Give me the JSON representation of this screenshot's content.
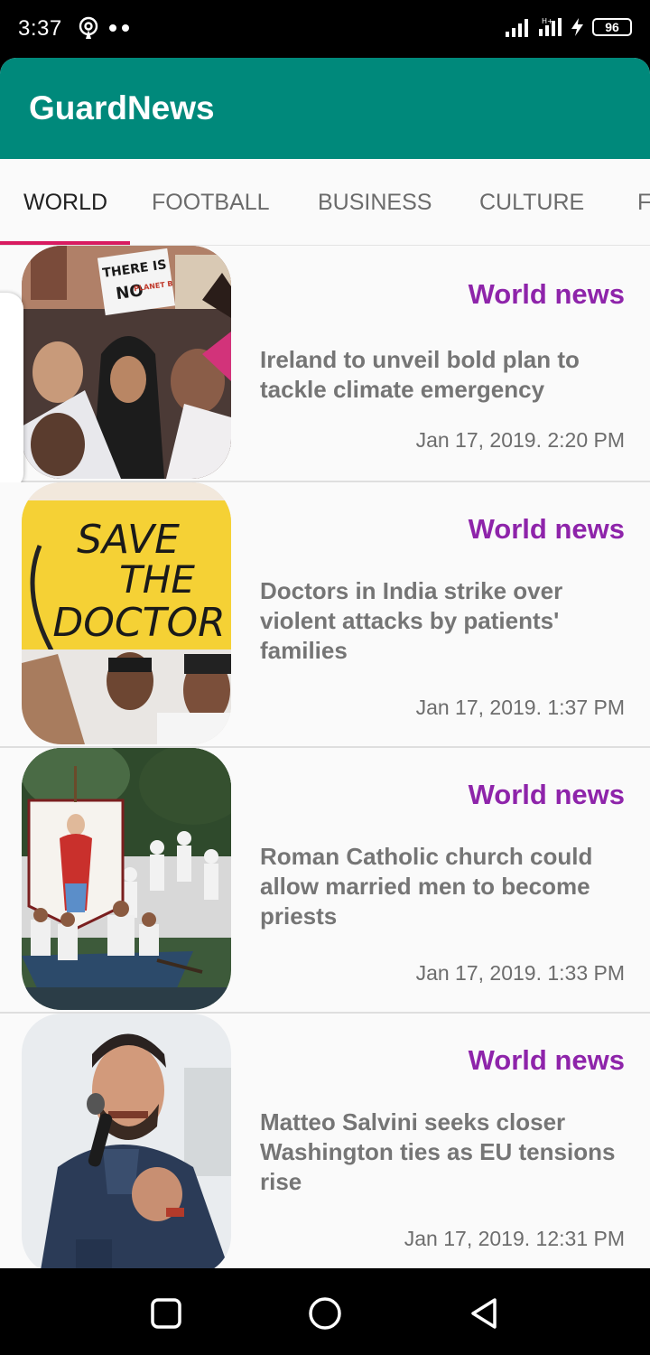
{
  "status_bar": {
    "time": "3:37",
    "battery": "96",
    "icons": [
      "hotspot-icon",
      "notification-dots-icon",
      "signal-icon",
      "signal-icon",
      "charging-icon",
      "battery-icon"
    ]
  },
  "app": {
    "title": "GuardNews",
    "accent_color": "#00897b",
    "indicator_color": "#d81b60",
    "section_color": "#8e24aa"
  },
  "tabs": [
    {
      "label": "WORLD",
      "active": true
    },
    {
      "label": "FOOTBALL",
      "active": false
    },
    {
      "label": "BUSINESS",
      "active": false
    },
    {
      "label": "CULTURE",
      "active": false
    },
    {
      "label": "F",
      "active": false
    }
  ],
  "articles": [
    {
      "section": "World news",
      "headline": "Ireland to unveil bold plan to tackle climate emergency",
      "date": "Jan 17, 2019. 2:20 PM",
      "image": "protest-photo",
      "sign_line1": "THERE IS",
      "sign_line2": "NO",
      "sign_line3": "PLANET B"
    },
    {
      "section": "World news",
      "headline": "Doctors in India strike over violent attacks by patients' families",
      "date": "Jan 17, 2019. 1:37 PM",
      "image": "save-the-doctor-photo",
      "sign_line1": "SAVE",
      "sign_line2": "THE",
      "sign_line3": "DOCTOR"
    },
    {
      "section": "World news",
      "headline": "Roman Catholic church could allow married men to become priests",
      "date": "Jan 17, 2019. 1:33 PM",
      "image": "boat-procession-photo"
    },
    {
      "section": "World news",
      "headline": "Matteo Salvini seeks closer Washington ties as EU tensions rise",
      "date": "Jan 17, 2019. 12:31 PM",
      "image": "speaker-photo"
    }
  ],
  "nav_bar": {
    "icons": [
      "recents-square-icon",
      "home-circle-icon",
      "back-triangle-icon"
    ]
  }
}
